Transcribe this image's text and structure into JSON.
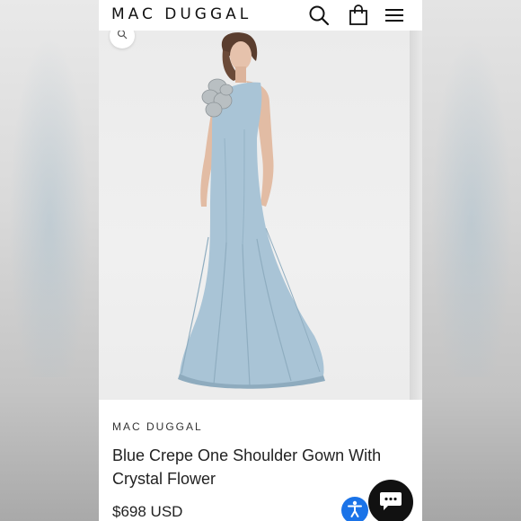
{
  "header": {
    "brand": "MAC DUGGAL",
    "icons": [
      "search-icon",
      "shopping-bag-icon",
      "hamburger-menu-icon"
    ]
  },
  "gallery": {
    "zoom_icon": "magnifier-icon"
  },
  "product": {
    "vendor": "MAC DUGGAL",
    "title": "Blue Crepe One Shoulder Gown With Crystal Flower",
    "price": "$698 USD"
  },
  "widgets": {
    "accessibility_icon": "accessibility-icon",
    "chat_icon": "chat-bubble-icon"
  },
  "colors": {
    "dress": "#a9c4d6",
    "accessibility": "#1a73e8",
    "chat": "#111111"
  }
}
